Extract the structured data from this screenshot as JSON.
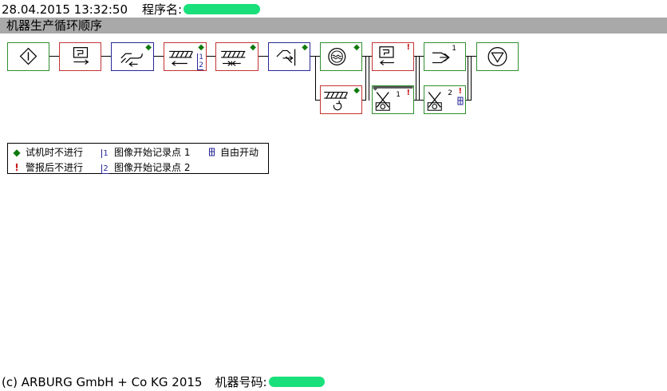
{
  "header": {
    "datetime": "28.04.2015 13:32:50",
    "program_label": "程序名:"
  },
  "title": "机器生产循环顺序",
  "steps_row1": [
    {
      "name": "cycle-start",
      "border": "green"
    },
    {
      "name": "mould-close",
      "border": "red"
    },
    {
      "name": "nozzle-forward",
      "border": "blue",
      "marker": "diamond"
    },
    {
      "name": "injection",
      "border": "red",
      "marker": "diamond",
      "image_points": [
        "1",
        "2"
      ]
    },
    {
      "name": "holding-pressure",
      "border": "red",
      "marker": "diamond"
    },
    {
      "name": "cooling-time",
      "border": "blue",
      "marker": "diamond"
    },
    {
      "name": "heating",
      "border": "green",
      "marker": "diamond"
    },
    {
      "name": "mould-open",
      "border": "red",
      "marker": "exclamation"
    },
    {
      "name": "removal",
      "border": "green",
      "number": "1"
    },
    {
      "name": "cycle-end",
      "border": "green"
    }
  ],
  "steps_row2": [
    {
      "name": "dosing",
      "border": "red",
      "marker": "diamond"
    },
    {
      "name": "ejector-1",
      "border": "green",
      "number": "1",
      "marker": "exclamation"
    },
    {
      "name": "ejector-2",
      "border": "green",
      "number": "2",
      "marker": "exclamation",
      "free_start": true
    }
  ],
  "legend": {
    "diamond_text": "试机时不进行",
    "exclamation_text": "警报后不进行",
    "image1_text": "图像开始记录点 1",
    "image2_text": "图像开始记录点 2",
    "free_start_text": "自由开动",
    "image1_icon": "1",
    "image2_icon": "2"
  },
  "footer": {
    "copyright": "(c) ARBURG GmbH + Co KG 2015",
    "machine_label": "机器号码:"
  },
  "colors": {
    "green": "#2f8f2f",
    "red": "#c43434",
    "blue": "#27279a",
    "title_bar": "#a9a9a9"
  }
}
